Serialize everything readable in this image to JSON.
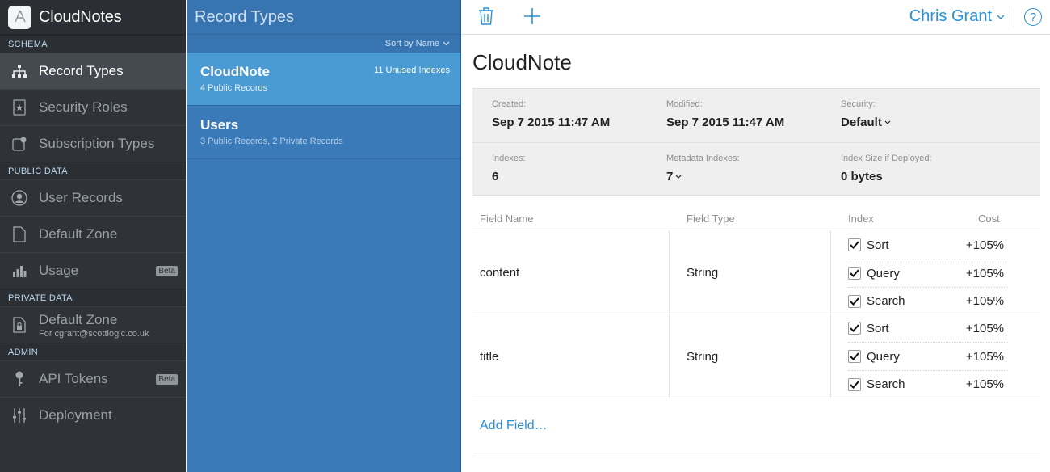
{
  "app": {
    "title": "CloudNotes"
  },
  "sidebar": {
    "sections": [
      {
        "label": "SCHEMA"
      },
      {
        "label": "PUBLIC DATA"
      },
      {
        "label": "PRIVATE DATA"
      },
      {
        "label": "ADMIN"
      }
    ],
    "items": [
      {
        "label": "Record Types",
        "icon": "hierarchy-icon",
        "active": true
      },
      {
        "label": "Security Roles",
        "icon": "security-role-icon"
      },
      {
        "label": "Subscription Types",
        "icon": "subscription-icon"
      },
      {
        "label": "User Records",
        "icon": "user-icon"
      },
      {
        "label": "Default Zone",
        "icon": "document-icon"
      },
      {
        "label": "Usage",
        "icon": "bar-chart-icon",
        "badge": "Beta"
      },
      {
        "label": "Default Zone",
        "sublabel": "For cgrant@scottlogic.co.uk",
        "icon": "lock-document-icon"
      },
      {
        "label": "API Tokens",
        "icon": "key-icon",
        "badge": "Beta"
      },
      {
        "label": "Deployment",
        "icon": "sliders-icon"
      }
    ]
  },
  "list": {
    "title": "Record Types",
    "sort_label": "Sort by Name",
    "records": [
      {
        "name": "CloudNote",
        "sub": "4 Public Records",
        "badge": "11 Unused Indexes",
        "selected": true
      },
      {
        "name": "Users",
        "sub": "3 Public Records, 2 Private Records"
      }
    ]
  },
  "toolbar": {
    "user_name": "Chris Grant",
    "help": "?"
  },
  "detail": {
    "title": "CloudNote",
    "info": {
      "created_label": "Created:",
      "created_value": "Sep 7 2015 11:47 AM",
      "modified_label": "Modified:",
      "modified_value": "Sep 7 2015 11:47 AM",
      "security_label": "Security:",
      "security_value": "Default",
      "indexes_label": "Indexes:",
      "indexes_value": "6",
      "metadata_label": "Metadata Indexes:",
      "metadata_value": "7",
      "size_label": "Index Size if Deployed:",
      "size_value": "0 bytes"
    },
    "table": {
      "headers": {
        "name": "Field Name",
        "type": "Field Type",
        "index": "Index",
        "cost": "Cost"
      },
      "rows": [
        {
          "name": "content",
          "type": "String",
          "indexes": [
            {
              "label": "Sort",
              "cost": "+105%",
              "checked": true
            },
            {
              "label": "Query",
              "cost": "+105%",
              "checked": true
            },
            {
              "label": "Search",
              "cost": "+105%",
              "checked": true
            }
          ]
        },
        {
          "name": "title",
          "type": "String",
          "indexes": [
            {
              "label": "Sort",
              "cost": "+105%",
              "checked": true
            },
            {
              "label": "Query",
              "cost": "+105%",
              "checked": true
            },
            {
              "label": "Search",
              "cost": "+105%",
              "checked": true
            }
          ]
        }
      ]
    },
    "add_field_label": "Add Field…"
  }
}
